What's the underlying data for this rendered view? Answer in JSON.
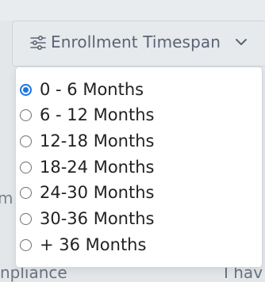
{
  "filter": {
    "label": "Enrollment Timespan",
    "icon": "sliders-icon",
    "chevron": "chevron-down-icon",
    "accent_color": "#1a73e8"
  },
  "background": {
    "left_fragment": "m",
    "bottom_left_fragment": "npliance",
    "bottom_right_fragment": "I hav"
  },
  "options": [
    {
      "label": "0 - 6 Months",
      "selected": true
    },
    {
      "label": "6 - 12 Months",
      "selected": false
    },
    {
      "label": "12-18 Months",
      "selected": false
    },
    {
      "label": "18-24 Months",
      "selected": false
    },
    {
      "label": "24-30 Months",
      "selected": false
    },
    {
      "label": "30-36 Months",
      "selected": false
    },
    {
      "label": "+ 36 Months",
      "selected": false
    }
  ]
}
